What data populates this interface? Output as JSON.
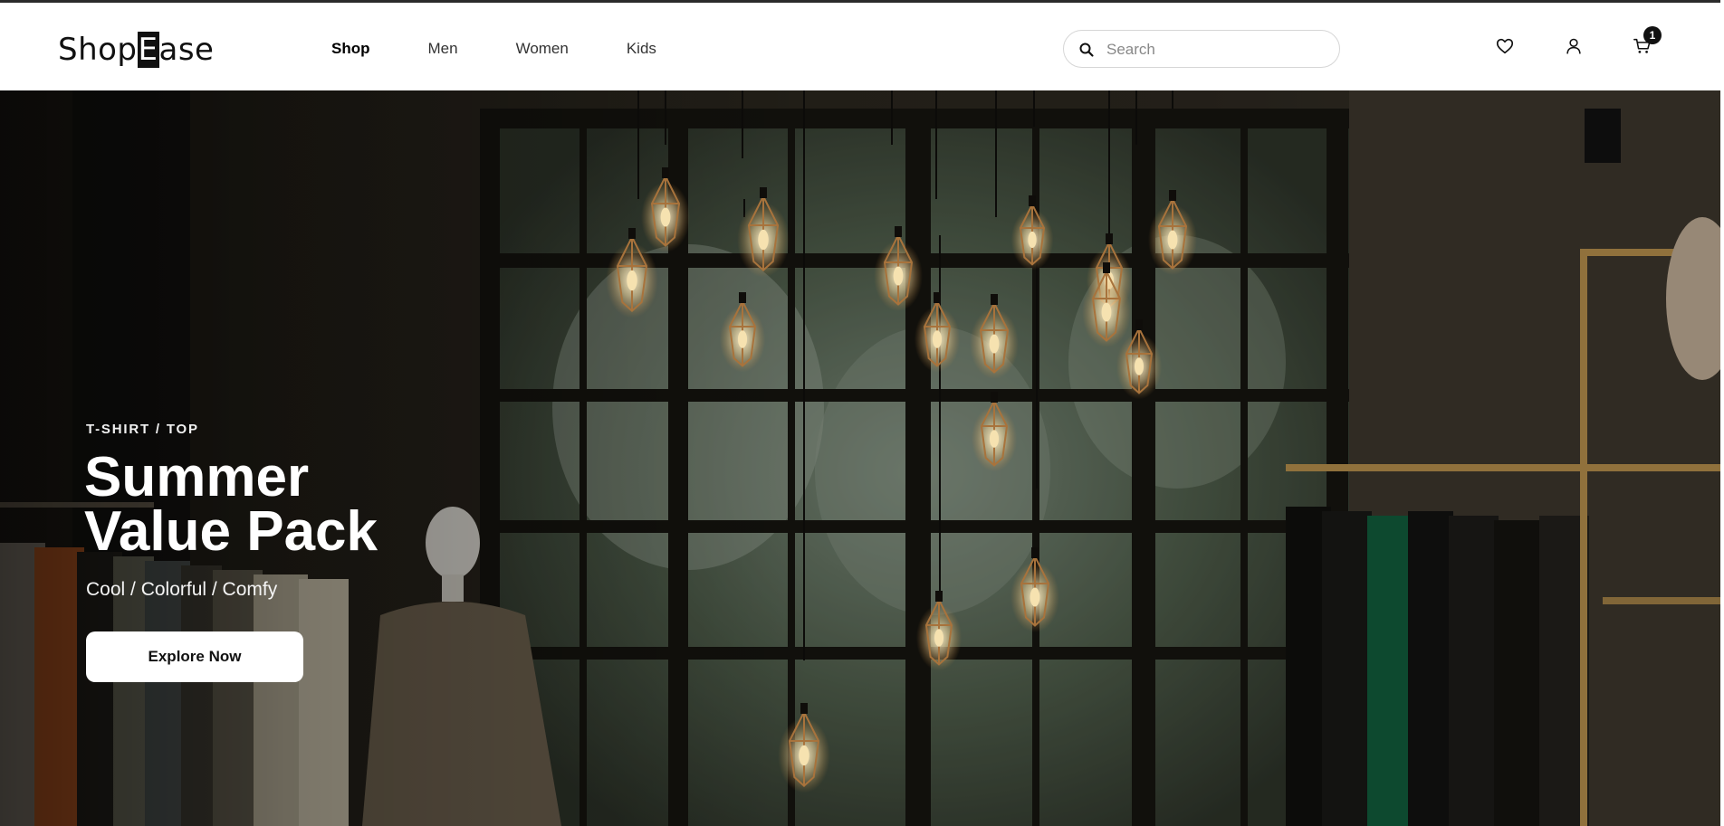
{
  "header": {
    "logo": {
      "pre": "Shop",
      "highlight": "E",
      "post": "ase"
    },
    "nav": [
      {
        "label": "Shop",
        "active": true
      },
      {
        "label": "Men",
        "active": false
      },
      {
        "label": "Women",
        "active": false
      },
      {
        "label": "Kids",
        "active": false
      }
    ],
    "search": {
      "placeholder": "Search",
      "value": ""
    },
    "icons": {
      "wishlist": "heart-icon",
      "account": "user-icon",
      "cart": "cart-icon",
      "search": "search-icon"
    },
    "cart_count": "1"
  },
  "hero": {
    "eyebrow": "T-SHIRT / TOP",
    "title_line1": "Summer",
    "title_line2": "Value Pack",
    "subtitle": "Cool / Colorful / Comfy",
    "cta_label": "Explore Now"
  },
  "colors": {
    "text_dark": "#111111",
    "header_bg": "#ffffff",
    "hero_overlay": "#1a1711",
    "bulb_glow": "#f6e2b0",
    "brass": "#a8733c"
  }
}
